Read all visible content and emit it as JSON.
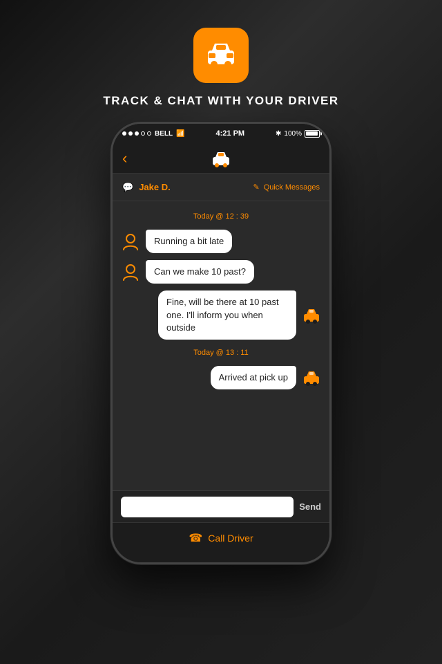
{
  "background": {
    "color": "#2a2a2a"
  },
  "app_icon": {
    "bg_color": "#ff8c00",
    "alt": "Taxi app icon"
  },
  "tagline": "TRACK & CHAT WITH YOUR DRIVER",
  "status_bar": {
    "signal_dots": [
      "filled",
      "filled",
      "filled",
      "empty",
      "empty"
    ],
    "carrier": "BELL",
    "wifi": "wifi",
    "time": "4:21 PM",
    "bluetooth": "BT",
    "battery_percent": "100%"
  },
  "nav": {
    "back_label": "‹",
    "title": "taxi-nav-icon"
  },
  "chat_header": {
    "icon": "chat-icon",
    "driver_name": "Jake D.",
    "quick_messages_icon": "pencil-icon",
    "quick_messages_label": "Quick Messages"
  },
  "messages": {
    "timestamp1": "Today @ 12 : 39",
    "msg1": "Running a bit late",
    "msg2": "Can we make 10 past?",
    "msg3": "Fine, will be there at 10 past one. I'll inform you when outside",
    "timestamp2": "Today @ 13 : 11",
    "msg4": "Arrived at pick up"
  },
  "input_bar": {
    "placeholder": "",
    "send_label": "Send"
  },
  "call_bar": {
    "icon": "phone-icon",
    "label": "Call Driver"
  }
}
